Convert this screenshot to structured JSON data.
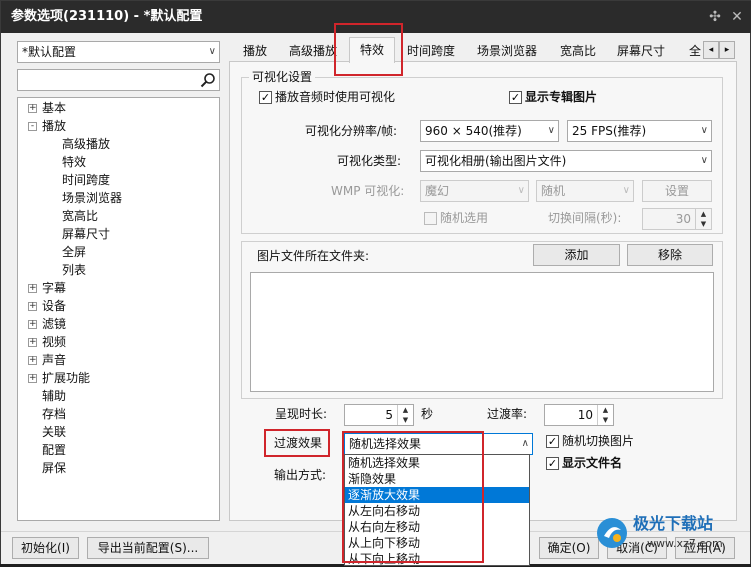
{
  "window": {
    "title": "参数选项(231110) - *默认配置",
    "pin_icon": "pin-icon",
    "close_icon": "close-icon"
  },
  "profile": {
    "selected": "*默认配置"
  },
  "search": {
    "placeholder": ""
  },
  "tree": {
    "groups": [
      {
        "label": "基本",
        "expander": "+"
      },
      {
        "label": "播放",
        "expander": "-",
        "children": [
          "高级播放",
          "特效",
          "时间跨度",
          "场景浏览器",
          "宽高比",
          "屏幕尺寸",
          "全屏",
          "列表"
        ]
      },
      {
        "label": "字幕",
        "expander": "+"
      },
      {
        "label": "设备",
        "expander": "+"
      },
      {
        "label": "滤镜",
        "expander": "+"
      },
      {
        "label": "视频",
        "expander": "+"
      },
      {
        "label": "声音",
        "expander": "+"
      },
      {
        "label": "扩展功能",
        "expander": "+"
      }
    ],
    "leaves": [
      "辅助",
      "存档",
      "关联",
      "配置",
      "屏保"
    ]
  },
  "tabs": [
    "播放",
    "高级播放",
    "特效",
    "时间跨度",
    "场景浏览器",
    "宽高比",
    "屏幕尺寸",
    "全"
  ],
  "active_tab": "特效",
  "tab_scroll": {
    "left": "◂",
    "right": "▸"
  },
  "vis": {
    "group_title": "可视化设置",
    "play_audio_vis": {
      "label": "播放音频时使用可视化",
      "checked": true
    },
    "show_album": {
      "label": "显示专辑图片",
      "checked": true
    },
    "resolution_label": "可视化分辨率/帧:",
    "resolution_value": "960 × 540(推荐)",
    "fps_value": "25 FPS(推荐)",
    "type_label": "可视化类型:",
    "type_value": "可视化相册(输出图片文件)",
    "wmp_label": "WMP 可视化:",
    "wmp_value": "魔幻",
    "wmp_mode": "随机",
    "setup_button": "设置",
    "random_select": {
      "label": "随机选用",
      "checked": false
    },
    "interval_label": "切换间隔(秒):",
    "interval_value": "30"
  },
  "folder": {
    "label": "图片文件所在文件夹:",
    "add_button": "添加",
    "remove_button": "移除"
  },
  "duration": {
    "label": "呈现时长:",
    "value": "5",
    "unit": "秒"
  },
  "transition_rate": {
    "label": "过渡率:",
    "value": "10"
  },
  "transition_effect": {
    "label": "过渡效果",
    "value": "随机选择效果",
    "options": [
      "随机选择效果",
      "渐隐效果",
      "逐渐放大效果",
      "从左向右移动",
      "从右向左移动",
      "从上向下移动",
      "从下向上移动"
    ],
    "selected_index": 2
  },
  "random_switch": {
    "label": "随机切换图片",
    "checked": true
  },
  "show_filename": {
    "label": "显示文件名",
    "checked": true
  },
  "output_label": "输出方式:",
  "bottom": {
    "init_button": "初始化(I)",
    "export_button": "导出当前配置(S)...",
    "ok_button": "确定(O)",
    "cancel_button": "取消(C)",
    "apply_button": "应用(A)"
  },
  "watermark": {
    "text": "极光下载站",
    "url": "www.xz7.com"
  }
}
